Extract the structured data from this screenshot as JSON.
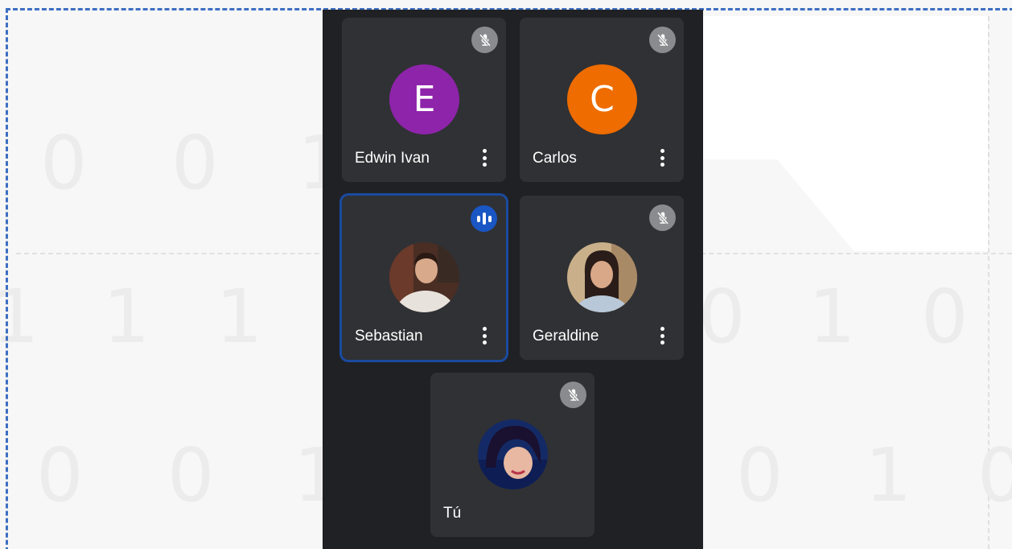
{
  "background": {
    "digits": [
      "0",
      "0",
      "1",
      "1",
      "1",
      "1",
      "0",
      "0",
      "1",
      "0",
      "1",
      "0",
      "0",
      "1",
      "0"
    ]
  },
  "colors": {
    "panel": "#202124",
    "tile": "#303134",
    "accent": "#1a56c4",
    "avatar_e": "#8e24aa",
    "avatar_c": "#ef6c00"
  },
  "participants": [
    {
      "name": "Edwin Ivan",
      "avatar": "letter",
      "initial": "E",
      "mic": "muted-mic-icon",
      "menu": "more-vert-icon"
    },
    {
      "name": "Carlos",
      "avatar": "letter",
      "initial": "C",
      "mic": "muted-mic-icon",
      "menu": "more-vert-icon"
    },
    {
      "name": "Sebastian",
      "avatar": "photo",
      "mic": "speaking-indicator-icon",
      "active_speaker": true,
      "menu": "more-vert-icon"
    },
    {
      "name": "Geraldine",
      "avatar": "photo",
      "mic": "muted-mic-icon",
      "menu": "more-vert-icon"
    },
    {
      "name": "Tú",
      "avatar": "photo",
      "mic": "muted-mic-icon"
    }
  ]
}
